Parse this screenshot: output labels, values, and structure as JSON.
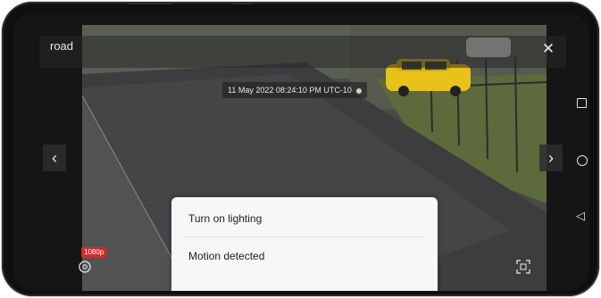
{
  "camera": {
    "name": "road",
    "timestamp": "11 May 2022 08:24:10 PM  UTC-10"
  },
  "controls": {
    "close_glyph": "✕",
    "prev_glyph": "‹",
    "next_glyph": "›",
    "quality_label": "1080p"
  },
  "menu": {
    "items": [
      {
        "label": "Turn on lighting"
      },
      {
        "label": "Motion detected"
      }
    ]
  },
  "system_nav": {
    "recents_icon": "square-icon",
    "home_icon": "circle-icon",
    "back_glyph": "◁"
  },
  "icons": {
    "settings": "gear-icon",
    "screenshot": "capture-frame-icon"
  },
  "colors": {
    "phone_body": "#0f0f10",
    "menu_background": "#f7f7f7",
    "quality_badge": "#d9262a",
    "car": "#e8c21a"
  }
}
